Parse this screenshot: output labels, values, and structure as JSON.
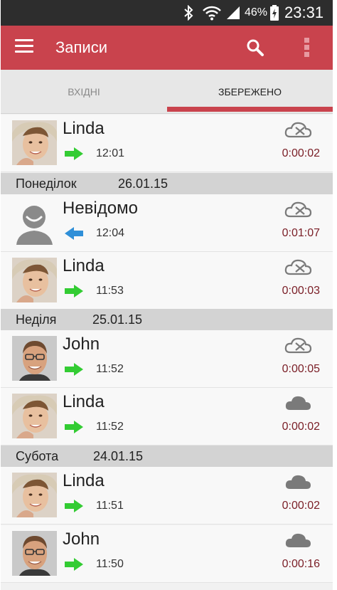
{
  "status_bar": {
    "battery": "46%",
    "time": "23:31"
  },
  "app_bar": {
    "title": "Записи"
  },
  "tabs": [
    {
      "label": "ВХІДНІ"
    },
    {
      "label": "ЗБЕРЕЖЕНО"
    }
  ],
  "list": {
    "rows": [
      {
        "name": "Linda",
        "time": "12:01",
        "duration": "0:00:02"
      },
      {
        "name": "Невідомо",
        "time": "12:04",
        "duration": "0:01:07"
      },
      {
        "name": "Linda",
        "time": "11:53",
        "duration": "0:00:03"
      },
      {
        "name": "John",
        "time": "11:52",
        "duration": "0:00:05"
      },
      {
        "name": "Linda",
        "time": "11:52",
        "duration": "0:00:02"
      },
      {
        "name": "Linda",
        "time": "11:51",
        "duration": "0:00:02"
      },
      {
        "name": "John",
        "time": "11:50",
        "duration": "0:00:16"
      }
    ],
    "headers": [
      {
        "day": "Понеділок",
        "date": "26.01.15"
      },
      {
        "day": "Неділя",
        "date": "25.01.15"
      },
      {
        "day": "Субота",
        "date": "24.01.15"
      }
    ]
  },
  "colors": {
    "accent": "#c9434d",
    "status_bar": "#2d2d2d",
    "outgoing_arrow": "#33cc33",
    "incoming_arrow": "#2f8fd8",
    "duration": "#7a1e26",
    "date_header": "#d3d3d3"
  },
  "icons": {
    "menu": "menu-icon",
    "search": "search-icon",
    "more": "more-vert-icon",
    "cloud_pending": "cloud-cross-icon",
    "cloud_saved": "cloud-icon",
    "outgoing": "arrow-right-icon",
    "incoming": "arrow-left-icon"
  }
}
